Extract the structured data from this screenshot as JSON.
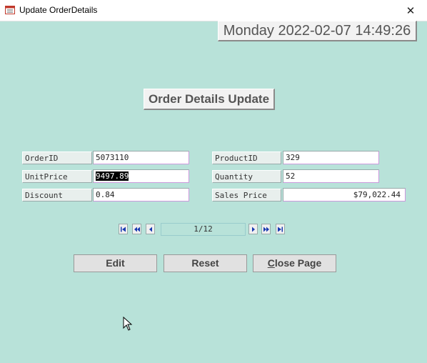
{
  "window": {
    "title": "Update OrderDetails",
    "close_symbol": "✕"
  },
  "datetime": "Monday 2022-02-07 14:49:26",
  "heading": "Order Details Update",
  "fields": {
    "order_id": {
      "label": "OrderID",
      "value": "5073110"
    },
    "unit_price": {
      "label": "UnitPrice",
      "value": "9497.89"
    },
    "discount": {
      "label": "Discount",
      "value": "0.84"
    },
    "product_id": {
      "label": "ProductID",
      "value": "329"
    },
    "quantity": {
      "label": "Quantity",
      "value": "52"
    },
    "sales_price": {
      "label": "Sales Price",
      "value": "$79,022.44"
    }
  },
  "navigator": {
    "record": "1/12"
  },
  "buttons": {
    "edit": "Edit",
    "reset": "Reset",
    "close_page_rest": "lose Page",
    "close_page_accel": "C"
  },
  "colors": {
    "background": "#b8e2d9",
    "nav_arrow": "#1a3ab0"
  },
  "icons": [
    "app-form-icon",
    "close-icon",
    "first-record-icon",
    "previous-page-icon",
    "previous-record-icon",
    "next-record-icon",
    "next-page-icon",
    "last-record-icon",
    "mouse-cursor-icon"
  ]
}
